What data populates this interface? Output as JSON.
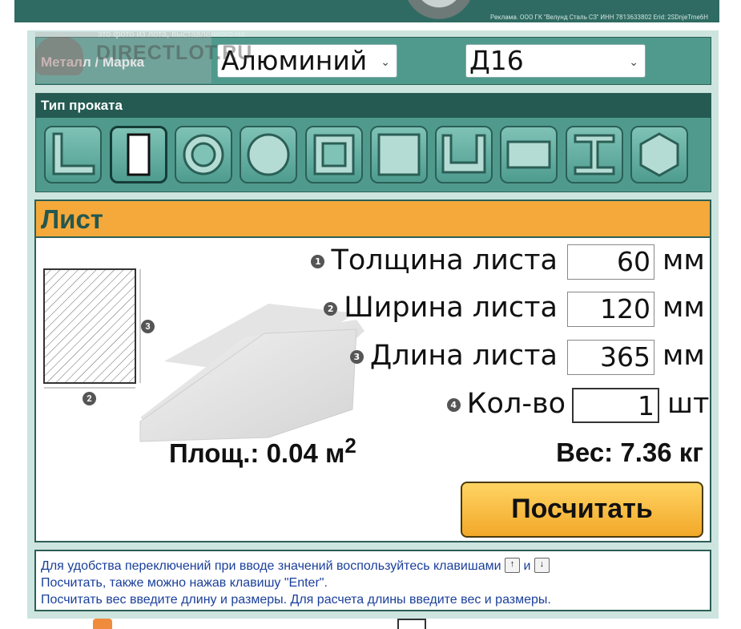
{
  "banner": {
    "legal_text": "Реклама. ООО ГК \"Велунд Сталь СЗ\" ИНН 7813633802 Erid: 2SDnjeTme6H"
  },
  "watermark": {
    "caption": "это фото из лота, выставленного на",
    "site": "DIRECTLOT.RU"
  },
  "metal": {
    "label": "Металл / Марка",
    "metal_value": "Алюминий",
    "grade_value": "Д16"
  },
  "profile": {
    "label": "Тип проката",
    "types": [
      "angle-icon",
      "sheet-icon",
      "pipe-round-icon",
      "round-bar-icon",
      "pipe-square-icon",
      "square-bar-icon",
      "channel-icon",
      "strip-icon",
      "i-beam-icon",
      "hexagon-icon"
    ],
    "selected": "sheet-icon"
  },
  "sheet": {
    "title": "Лист",
    "fields": [
      {
        "num": "1",
        "label": "Толщина листа",
        "value": "60",
        "unit": "мм"
      },
      {
        "num": "2",
        "label": "Ширина листа",
        "value": "120",
        "unit": "мм"
      },
      {
        "num": "3",
        "label": "Длина листа",
        "value": "365",
        "unit": "мм"
      },
      {
        "num": "4",
        "label": "Кол-во",
        "value": "1",
        "unit": "шт"
      }
    ],
    "area_label": "Площ.: 0.04 м",
    "area_sup": "2",
    "weight": "Вес: 7.36 кг",
    "calc_button": "Посчитать",
    "diagram_marks": [
      "3",
      "2"
    ]
  },
  "help": {
    "line1_a": "Для удобства переключений при вводе значений воспользуйтесь клавишами",
    "key_up": "↑",
    "and": "и",
    "key_down": "↓",
    "line2": "Посчитать, также можно нажав клавишу \"Enter\".",
    "line3": "Посчитать вес введите длину и размеры. Для расчета длины введите вес и размеры."
  },
  "colors": {
    "teal": "#4f9a8c",
    "dark_teal": "#245a52",
    "orange": "#f4a93a",
    "help_text": "#1a3f9a"
  }
}
